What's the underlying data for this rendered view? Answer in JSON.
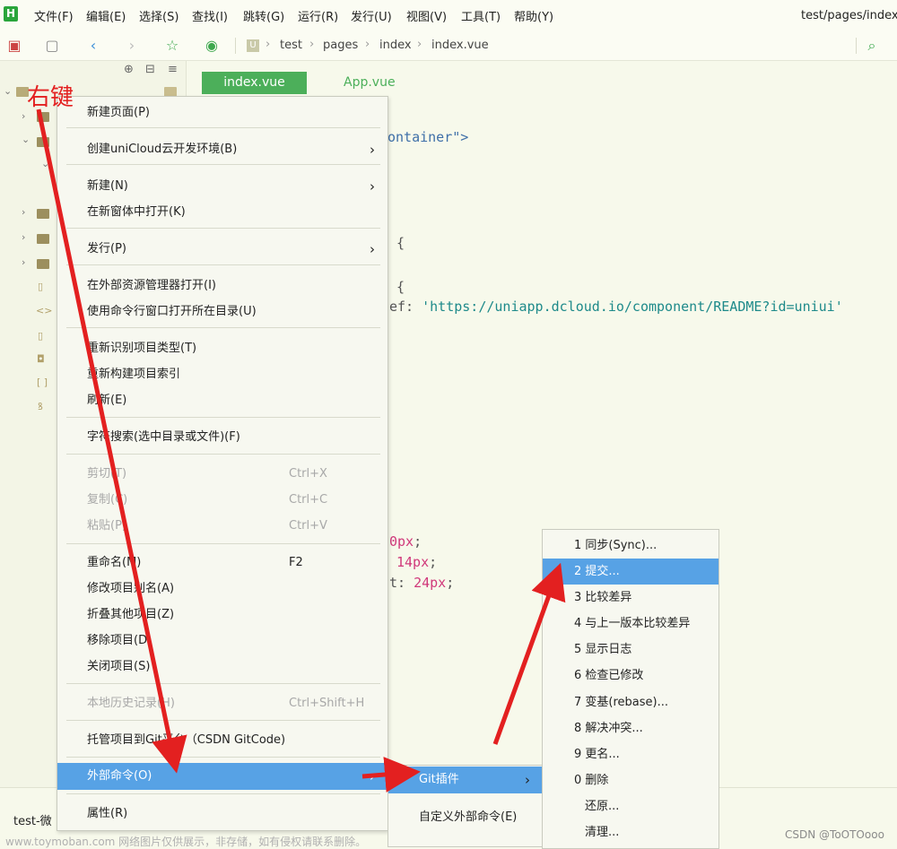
{
  "menubar": {
    "logo": "H",
    "items": [
      "文件(F)",
      "编辑(E)",
      "选择(S)",
      "查找(I)",
      "跳转(G)",
      "运行(R)",
      "发行(U)",
      "视图(V)",
      "工具(T)",
      "帮助(Y)"
    ],
    "path_title": "test/pages/index,"
  },
  "toolbar": {
    "crumb_icon": "U",
    "breadcrumb": [
      "test",
      "pages",
      "index",
      "index.vue"
    ]
  },
  "editor": {
    "tabs": [
      {
        "label": "index.vue",
        "active": true
      },
      {
        "label": "App.vue",
        "active": false
      }
    ],
    "code_lines": {
      "l1": "ontainer\">",
      "l2": "{",
      "l3": "{",
      "l4_key": "ef: ",
      "l4_str": "'https://uniapp.dcloud.io/component/README?id=uniui'",
      "l5_num": "0px",
      "l5_end": ";",
      "l6_num": "14px",
      "l6_end": ";",
      "l7_key": "t: ",
      "l7_num": "24px",
      "l7_end": ";"
    }
  },
  "context_menu": {
    "items": [
      {
        "label": "新建页面(P)"
      },
      {
        "label": "创建uniCloud云开发环境(B)",
        "submenu": true
      },
      {
        "label": "新建(N)",
        "submenu": true
      },
      {
        "label": "在新窗体中打开(K)"
      },
      {
        "label": "发行(P)",
        "submenu": true
      },
      {
        "label": "在外部资源管理器打开(I)"
      },
      {
        "label": "使用命令行窗口打开所在目录(U)"
      },
      {
        "label": "重新识别项目类型(T)"
      },
      {
        "label": "重新构建项目索引"
      },
      {
        "label": "刷新(E)"
      },
      {
        "label": "字符搜索(选中目录或文件)(F)"
      },
      {
        "label": "剪切(T)",
        "shortcut": "Ctrl+X",
        "disabled": true
      },
      {
        "label": "复制(C)",
        "shortcut": "Ctrl+C",
        "disabled": true
      },
      {
        "label": "粘贴(P)",
        "shortcut": "Ctrl+V",
        "disabled": true
      },
      {
        "label": "重命名(M)",
        "shortcut": "F2"
      },
      {
        "label": "修改项目别名(A)"
      },
      {
        "label": "折叠其他项目(Z)"
      },
      {
        "label": "移除项目(D)"
      },
      {
        "label": "关闭项目(S)"
      },
      {
        "label": "本地历史记录(H)",
        "shortcut": "Ctrl+Shift+H",
        "disabled": true
      },
      {
        "label": "托管项目到Git平台（CSDN GitCode)"
      },
      {
        "label": "外部命令(O)",
        "submenu": true,
        "selected": true
      },
      {
        "label": "属性(R)"
      }
    ]
  },
  "submenu_external": {
    "items": [
      {
        "label": "Git插件",
        "submenu": true,
        "selected": true
      },
      {
        "label": "自定义外部命令(E)"
      }
    ]
  },
  "submenu_git": {
    "items": [
      {
        "label": "1 同步(Sync)..."
      },
      {
        "label": "2 提交...",
        "selected": true
      },
      {
        "label": "3 比较差异"
      },
      {
        "label": "4 与上一版本比较差异"
      },
      {
        "label": "5 显示日志"
      },
      {
        "label": "6 检查已修改"
      },
      {
        "label": "7 变基(rebase)..."
      },
      {
        "label": "8 解决冲突..."
      },
      {
        "label": "9 更名..."
      },
      {
        "label": "0 删除"
      },
      {
        "label": "还原..."
      },
      {
        "label": "清理..."
      }
    ]
  },
  "annotation": {
    "label": "右键",
    "color": "#e32020"
  },
  "status": {
    "project": "test-微"
  },
  "watermarks": {
    "left": "www.toymoban.com 网络图片仅供展示，非存储，如有侵权请联系删除。",
    "right": "CSDN @ToOTOooo"
  },
  "colors": {
    "accent": "#57a2e5",
    "tab_active": "#4caf5a",
    "arrow": "#e32020"
  }
}
